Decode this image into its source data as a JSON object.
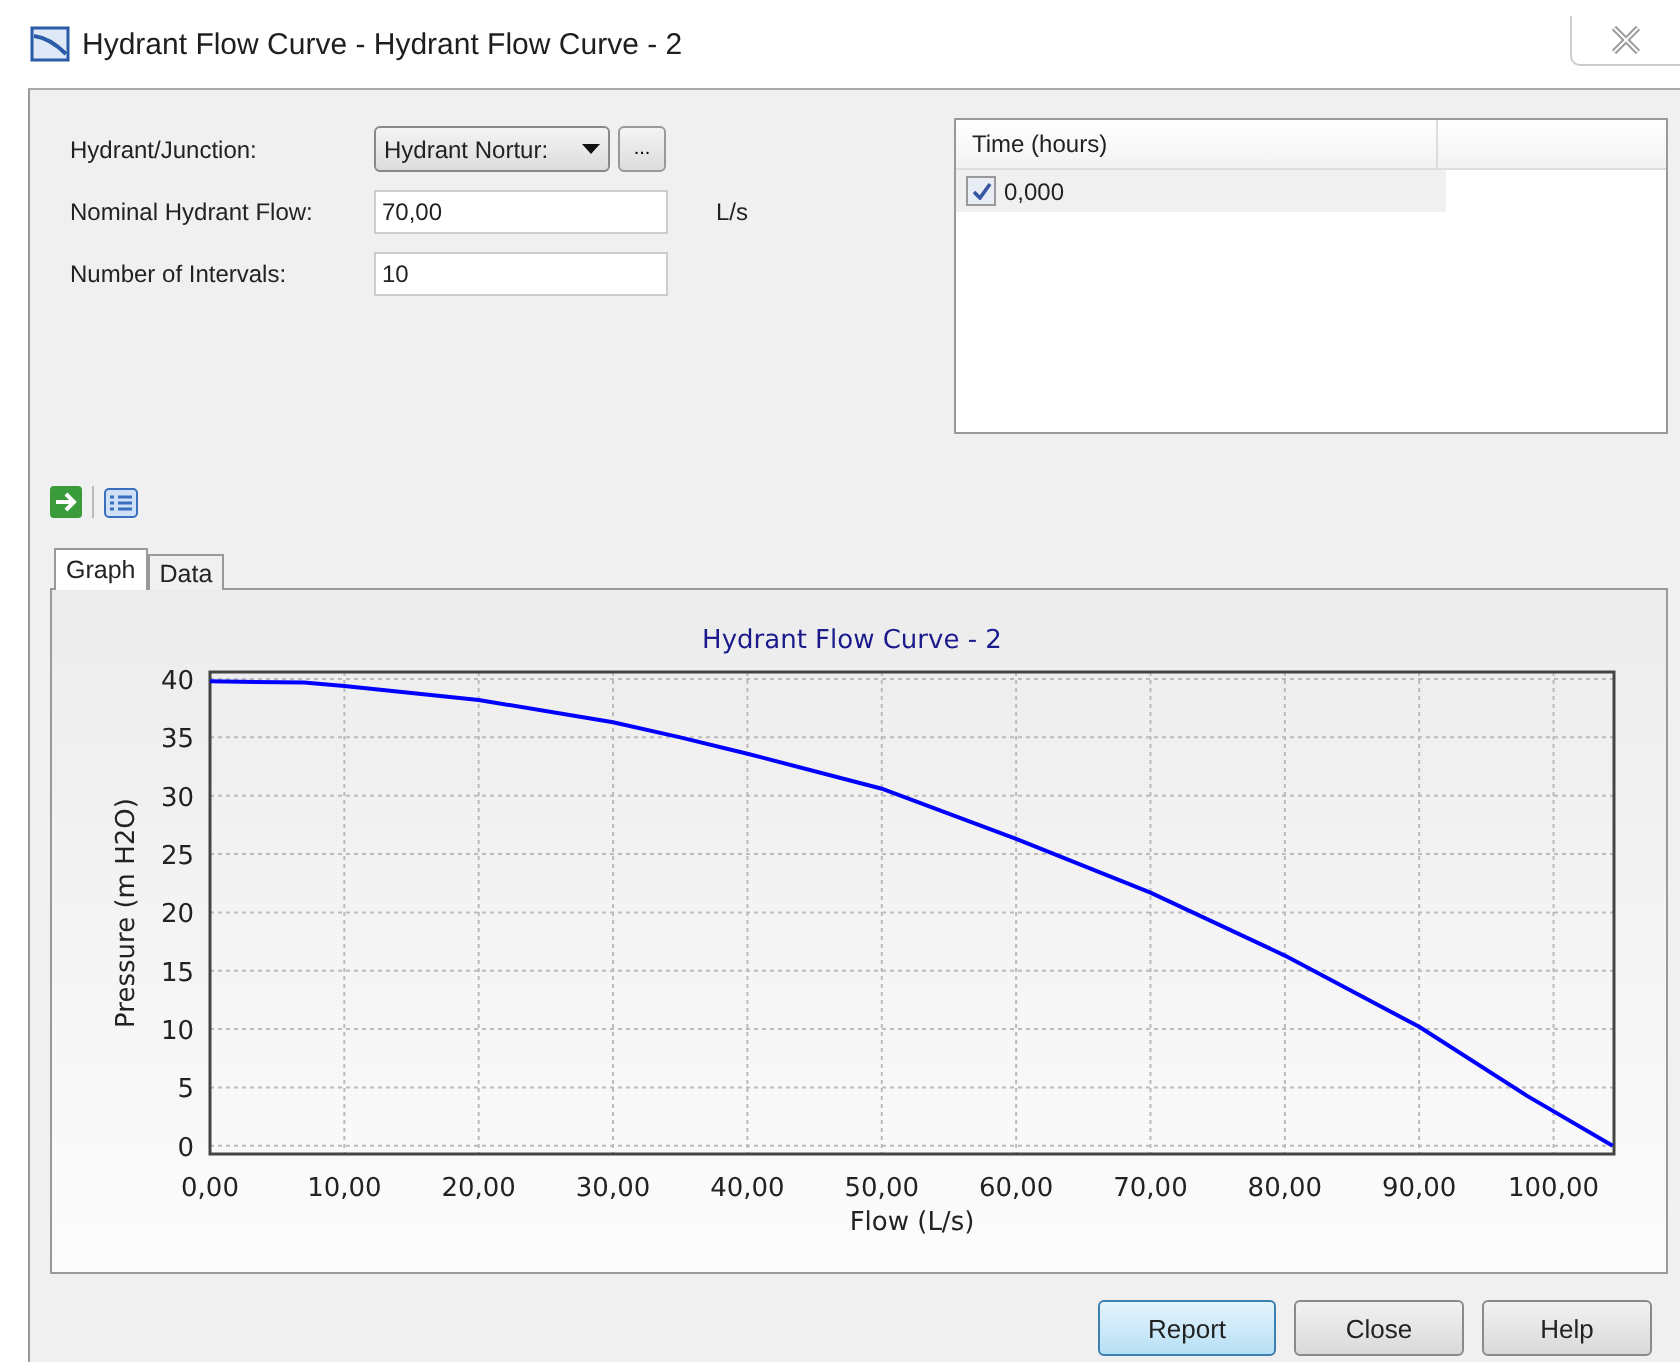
{
  "window": {
    "title": "Hydrant Flow Curve - Hydrant Flow Curve - 2"
  },
  "fields": [
    {
      "kind": "dropdown",
      "label": "Hydrant/Junction:",
      "value": "Hydrant Nortur:",
      "browse": "..."
    },
    {
      "kind": "text",
      "label": "Nominal Hydrant Flow:",
      "value": "70,00",
      "unit": "L/s"
    },
    {
      "kind": "text",
      "label": "Number of Intervals:",
      "value": "10"
    }
  ],
  "time_table": {
    "columns": [
      "Time (hours)"
    ],
    "rows": [
      {
        "value": "0,000",
        "checked": true,
        "selected": true
      }
    ]
  },
  "tabs": [
    {
      "label": "Graph",
      "selected": true
    },
    {
      "label": "Data",
      "selected": false
    }
  ],
  "graph": {
    "chart_data": {
      "type": "line",
      "title": "Hydrant Flow Curve - 2",
      "xlabel": "Flow (L/s)",
      "ylabel": "Pressure (m H2O)",
      "x": [
        0,
        7,
        10,
        20,
        30,
        35,
        40,
        50,
        60,
        70,
        80,
        90,
        98,
        104.4
      ],
      "grid": true,
      "series": [
        {
          "color": "#0000ff",
          "values": [
            39.8,
            39.7,
            39.4,
            38.2,
            36.3,
            35.0,
            33.6,
            30.6,
            26.3,
            21.7,
            16.3,
            10.2,
            4.3,
            0
          ]
        }
      ],
      "xlim": [
        0,
        104.5
      ],
      "ylim": [
        -0.7,
        40.6
      ],
      "xticks": [
        {
          "value": 0,
          "label": "0,00"
        },
        {
          "value": 10,
          "label": "10,00"
        },
        {
          "value": 20,
          "label": "20,00"
        },
        {
          "value": 30,
          "label": "30,00"
        },
        {
          "value": 40,
          "label": "40,00"
        },
        {
          "value": 50,
          "label": "50,00"
        },
        {
          "value": 60,
          "label": "60,00"
        },
        {
          "value": 70,
          "label": "70,00"
        },
        {
          "value": 80,
          "label": "80,00"
        },
        {
          "value": 90,
          "label": "90,00"
        },
        {
          "value": 100,
          "label": "100,00"
        }
      ],
      "yticks": [
        0,
        5,
        10,
        15,
        20,
        25,
        30,
        35,
        40
      ]
    }
  },
  "buttons": [
    {
      "label": "Report",
      "focused": true
    },
    {
      "label": "Close",
      "focused": false
    },
    {
      "label": "Help",
      "focused": false
    }
  ]
}
